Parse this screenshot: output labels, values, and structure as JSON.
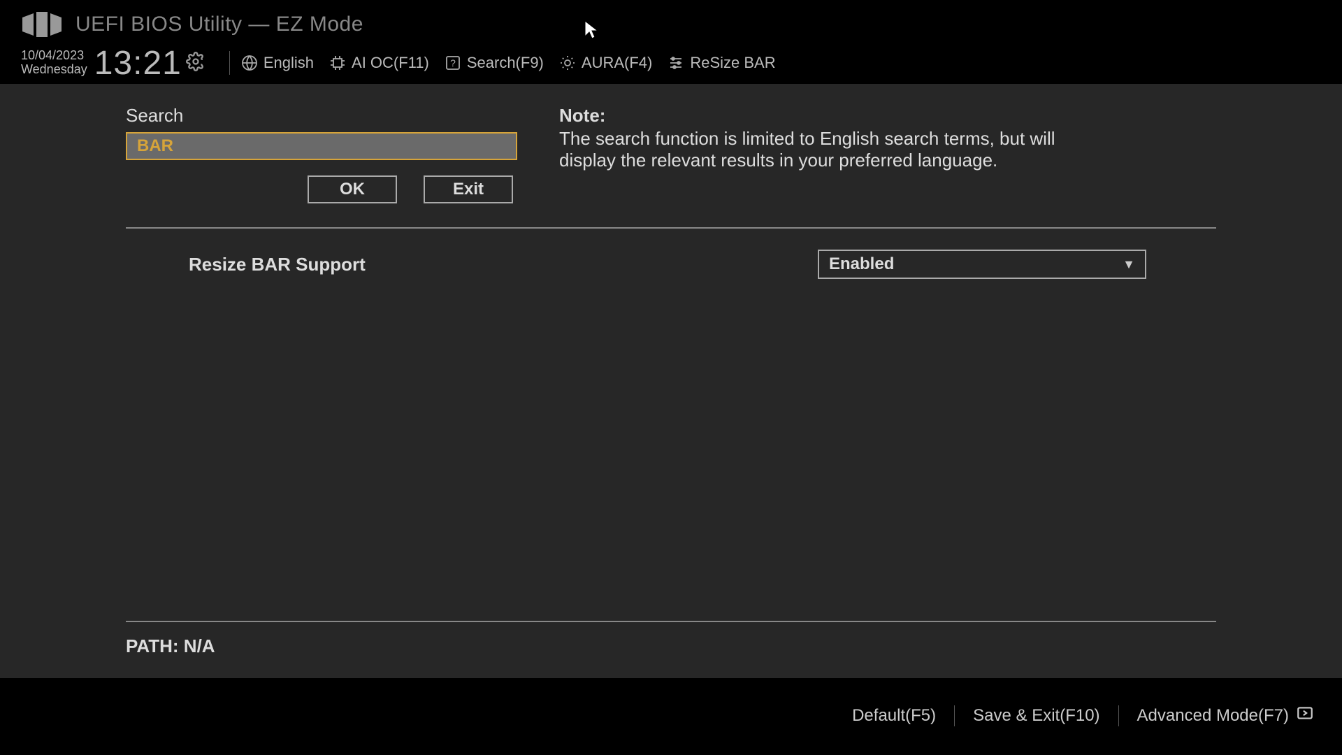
{
  "header": {
    "title": "UEFI BIOS Utility — EZ Mode"
  },
  "status": {
    "date": "10/04/2023",
    "weekday": "Wednesday",
    "time": "13:21",
    "language": "English",
    "aioc": "AI OC(F11)",
    "search": "Search(F9)",
    "aura": "AURA(F4)",
    "resizebar": "ReSize BAR"
  },
  "search": {
    "label": "Search",
    "value": "BAR",
    "ok": "OK",
    "exit": "Exit"
  },
  "note": {
    "title": "Note:",
    "text": "The search function is limited to English search terms, but will display the relevant results in your preferred language."
  },
  "result": {
    "label": "Resize BAR Support",
    "value": "Enabled"
  },
  "path": {
    "label": "PATH: N/A"
  },
  "footer": {
    "default": "Default(F5)",
    "save": "Save & Exit(F10)",
    "advanced": "Advanced Mode(F7)"
  }
}
